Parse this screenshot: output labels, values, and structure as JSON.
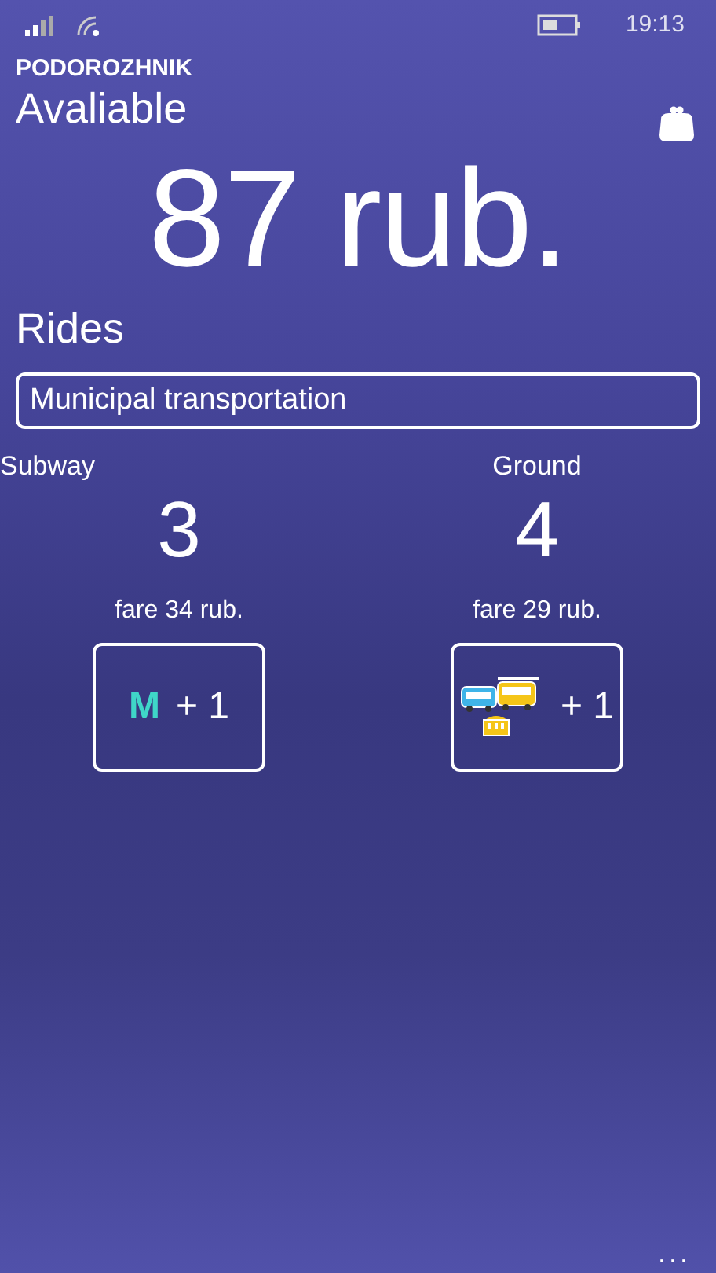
{
  "status_bar": {
    "time": "19:13"
  },
  "app_title": "PODOROZHNIK",
  "balance": {
    "label": "Avaliable",
    "amount": "87 rub."
  },
  "rides": {
    "label": "Rides",
    "card_type": "Municipal transportation"
  },
  "counters": [
    {
      "kind": "subway",
      "label": "Subway",
      "count": "3",
      "fare": "fare 34 rub.",
      "button": {
        "glyph": "M",
        "text": "+ 1"
      }
    },
    {
      "kind": "ground",
      "label": "Ground",
      "count": "4",
      "fare": "fare 29 rub.",
      "button": {
        "text": "+ 1"
      }
    }
  ],
  "app_bar": {
    "more": "..."
  }
}
